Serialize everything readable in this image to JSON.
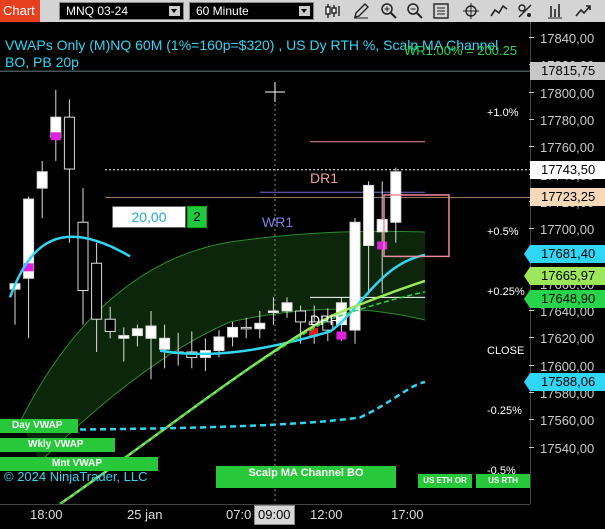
{
  "toolbar": {
    "tab_label": "Chart",
    "instrument": "MNQ 03-24",
    "interval": "60 Minute",
    "icons": [
      "bar-style-icon",
      "draw-pencil-icon",
      "zoom-in-icon",
      "zoom-out-icon",
      "properties-icon",
      "crosshair-icon",
      "indicators-icon",
      "strategies-icon"
    ]
  },
  "chart": {
    "title": "VWAPs Only (M)NQ 60M (1%=160p=$320) , US Dy RTH %, Scalp MA Channel BO, PB 20p",
    "wr_overlay": "WR1.00% = 200.25",
    "copyright": "© 2024 NinjaTrader, LLC",
    "labels": {
      "dr1": "DR1",
      "wr1": "WR1",
      "dpp": "DPP"
    },
    "input_box": {
      "value": "20,00",
      "button": "2"
    },
    "levels": [
      {
        "label": "+1.0%",
        "color": "#f08aa0"
      },
      {
        "label": "+0.5%",
        "color": "#f08aa0"
      },
      {
        "label": "+0.25%",
        "color": "#f08aa0"
      },
      {
        "label": "CLOSE",
        "color": "#e0403a"
      },
      {
        "label": "-0.25%",
        "color": "#f08aa0"
      },
      {
        "label": "-0.5%",
        "color": "#f08aa0"
      }
    ],
    "legend": {
      "day_vwap": "Day VWAP",
      "wkly_vwap": "Wkly VWAP",
      "mnt_vwap": "Mnt VWAP",
      "scalp": "Scalp MA Channel BO",
      "us_ethor": "US ETH OR",
      "us_rth": "US RTH"
    },
    "price_ticks": [
      "17840,00",
      "17820,00",
      "17800,00",
      "17780,00",
      "17760,00",
      "17740,00",
      "17720,00",
      "17700,00",
      "17680,00",
      "17660,00",
      "17640,00",
      "17620,00",
      "17600,00",
      "17580,00",
      "17560,00",
      "17540,00"
    ],
    "price_badges": [
      {
        "value": "17815,75",
        "bg": "#c8c8c8",
        "fg": "#000"
      },
      {
        "value": "17743,50",
        "bg": "#ffffff",
        "fg": "#000"
      },
      {
        "value": "17723,25",
        "bg": "#f5d9b8",
        "fg": "#000"
      },
      {
        "value": "17681,40",
        "bg": "#2fd6f5",
        "fg": "#000"
      },
      {
        "value": "17665,97",
        "bg": "#9ce85a",
        "fg": "#000"
      },
      {
        "value": "17648,90",
        "bg": "#27d44a",
        "fg": "#000"
      },
      {
        "value": "17588,06",
        "bg": "#2fd6f5",
        "fg": "#000"
      }
    ],
    "time_labels": [
      "18:00",
      "25 jan",
      "07:0",
      "09:00",
      "12:00",
      "17:00"
    ]
  },
  "chart_data": {
    "type": "candlestick",
    "ylim": [
      17530,
      17850
    ],
    "candles": [
      {
        "o": 17656,
        "h": 17660,
        "l": 17630,
        "c": 17660
      },
      {
        "o": 17664,
        "h": 17724,
        "l": 17620,
        "c": 17722
      },
      {
        "o": 17730,
        "h": 17750,
        "l": 17708,
        "c": 17742
      },
      {
        "o": 17767,
        "h": 17802,
        "l": 17750,
        "c": 17782
      },
      {
        "o": 17782,
        "h": 17795,
        "l": 17690,
        "c": 17744
      },
      {
        "o": 17705,
        "h": 17730,
        "l": 17630,
        "c": 17655
      },
      {
        "o": 17675,
        "h": 17690,
        "l": 17610,
        "c": 17634
      },
      {
        "o": 17634,
        "h": 17643,
        "l": 17620,
        "c": 17625
      },
      {
        "o": 17620,
        "h": 17628,
        "l": 17603,
        "c": 17622
      },
      {
        "o": 17622,
        "h": 17630,
        "l": 17614,
        "c": 17627
      },
      {
        "o": 17620,
        "h": 17640,
        "l": 17590,
        "c": 17629
      },
      {
        "o": 17612,
        "h": 17630,
        "l": 17598,
        "c": 17620
      },
      {
        "o": 17610,
        "h": 17624,
        "l": 17600,
        "c": 17609
      },
      {
        "o": 17610,
        "h": 17625,
        "l": 17598,
        "c": 17606
      },
      {
        "o": 17606,
        "h": 17620,
        "l": 17596,
        "c": 17611
      },
      {
        "o": 17611,
        "h": 17626,
        "l": 17606,
        "c": 17621
      },
      {
        "o": 17621,
        "h": 17632,
        "l": 17614,
        "c": 17628
      },
      {
        "o": 17628,
        "h": 17635,
        "l": 17620,
        "c": 17627
      },
      {
        "o": 17627,
        "h": 17640,
        "l": 17620,
        "c": 17631
      },
      {
        "o": 17640,
        "h": 17650,
        "l": 17630,
        "c": 17640
      },
      {
        "o": 17640,
        "h": 17650,
        "l": 17635,
        "c": 17646
      },
      {
        "o": 17640,
        "h": 17644,
        "l": 17616,
        "c": 17632
      },
      {
        "o": 17632,
        "h": 17644,
        "l": 17616,
        "c": 17630
      },
      {
        "o": 17632,
        "h": 17642,
        "l": 17618,
        "c": 17626
      },
      {
        "o": 17630,
        "h": 17650,
        "l": 17618,
        "c": 17646
      },
      {
        "o": 17626,
        "h": 17708,
        "l": 17616,
        "c": 17705
      },
      {
        "o": 17688,
        "h": 17735,
        "l": 17652,
        "c": 17732
      },
      {
        "o": 17698,
        "h": 17735,
        "l": 17653,
        "c": 17707
      },
      {
        "o": 17705,
        "h": 17745,
        "l": 17690,
        "c": 17742
      }
    ],
    "series": [
      {
        "name": "Day VWAP",
        "color": "#2fd6f5"
      },
      {
        "name": "Wkly VWAP",
        "color": "#27d44a"
      },
      {
        "name": "Mnt VWAP",
        "color": "#2fd6f5"
      }
    ]
  }
}
